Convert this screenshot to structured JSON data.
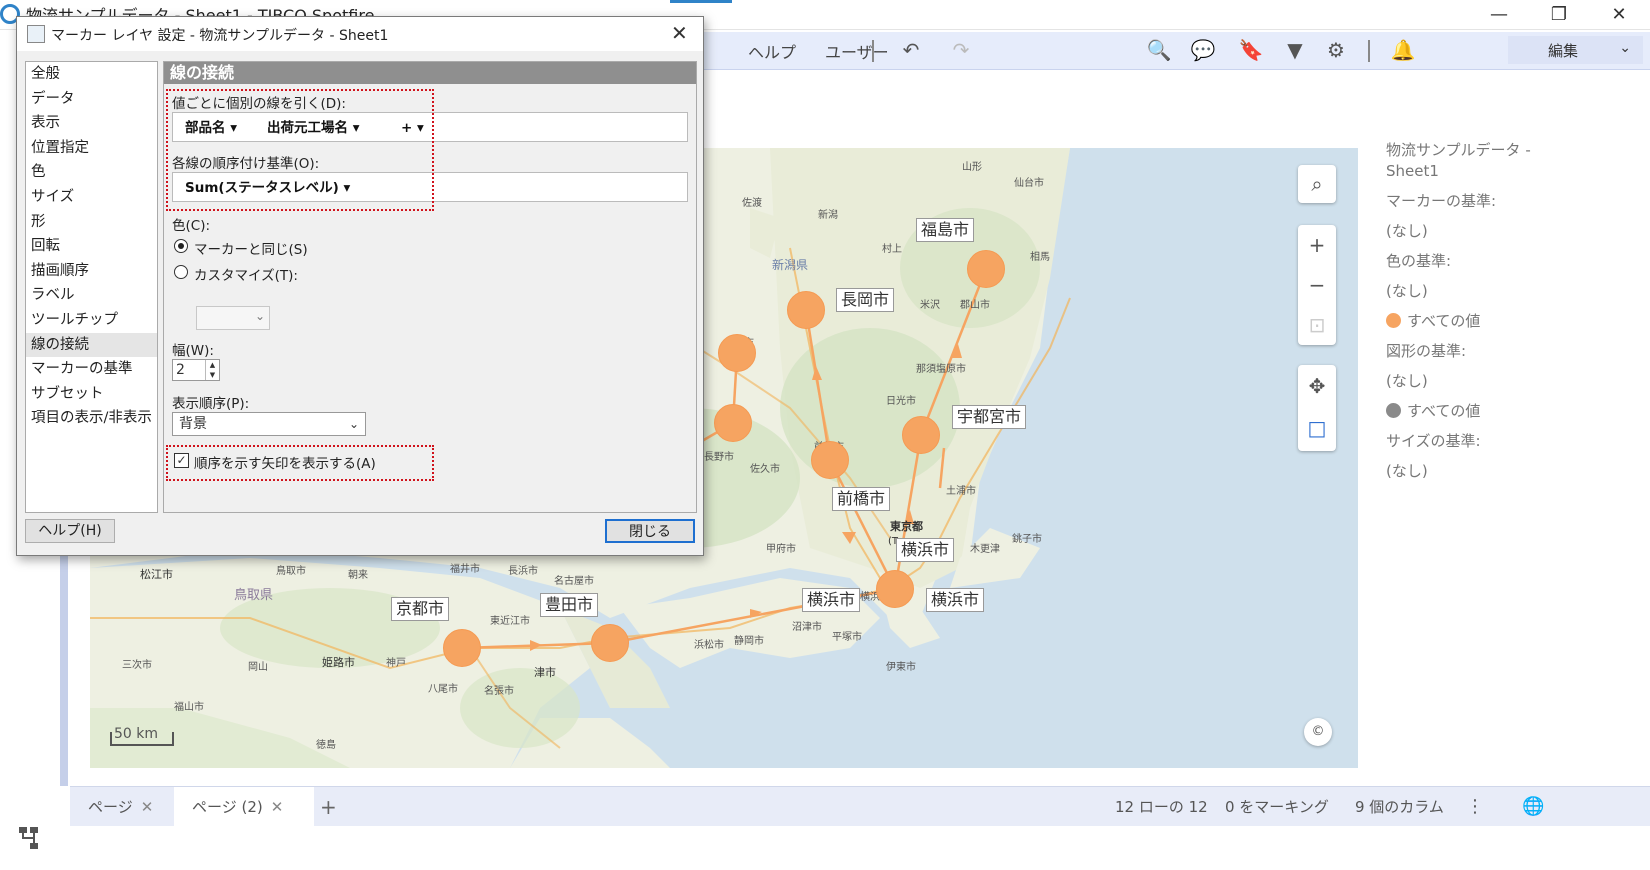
{
  "app": {
    "title": "物流サンプルデータ - Sheet1 - TIBCO Spotfire",
    "min": "—",
    "max": "❐",
    "close": "✕"
  },
  "toolbar": {
    "help": "ヘルプ",
    "user": "ユーザー",
    "edit": "編集",
    "edit_chevron": "⌄",
    "icons": {
      "undo": "↶",
      "redo": "↷",
      "search": "🔍",
      "comments": "💬",
      "bookmark": "🔖",
      "filter": "▼",
      "settings": "⚙",
      "notifications": "🔔"
    }
  },
  "dialog": {
    "title": "マーカー レイヤ 設定 - 物流サンプルデータ - Sheet1",
    "close": "✕",
    "nav": [
      "全般",
      "データ",
      "表示",
      "位置指定",
      "色",
      "サイズ",
      "形",
      "回転",
      "描画順序",
      "ラベル",
      "ツールチップ",
      "線の接続",
      "マーカーの基準",
      "サブセット",
      "項目の表示/非表示"
    ],
    "selected_nav": "線の接続",
    "panel": {
      "header": "線の接続",
      "line_by_label": "値ごとに個別の線を引く(D):",
      "line_by_tokens": [
        "部品名 ▾",
        "出荷元工場名 ▾",
        "+ ▾"
      ],
      "order_label": "各線の順序付け基準(O):",
      "order_token": "Sum(ステータスレベル) ▾",
      "color_label": "色(C):",
      "color_same": "マーカーと同じ(S)",
      "color_custom": "カスタマイズ(T):",
      "color_chev": "⌄",
      "width_label": "幅(W):",
      "width_value": "2",
      "spin_up": "▲",
      "spin_down": "▼",
      "display_order_label": "表示順序(P):",
      "display_order_value": "背景",
      "select_chev": "⌄",
      "arrows_label": "順序を示す矢印を表示する(A)",
      "arrows_checked": "✓"
    },
    "help_button": "ヘルプ(H)",
    "close_button": "閉じる"
  },
  "map": {
    "cities": [
      "福島市",
      "長岡市",
      "宇都宮市",
      "前橋市",
      "横浜市",
      "横浜市",
      "横浜市",
      "豊田市",
      "京都市"
    ],
    "scale": "50 km",
    "tools": {
      "search": "⌕",
      "zoom_in": "+",
      "zoom_out": "−",
      "zoom_fit": "⊡",
      "pan": "✥",
      "select": "□",
      "copyright": "©"
    },
    "bg_labels": [
      "新潟県",
      "鳥取県",
      "山形",
      "仙台市",
      "新潟",
      "佐渡",
      "郡山市",
      "相馬",
      "日光市",
      "那須塩原市",
      "前橋市",
      "土浦市",
      "東京都",
      "(T",
      "甲府市",
      "横浜市",
      "静岡市",
      "沼津市",
      "浜松市",
      "名古屋市",
      "津市",
      "東近江市",
      "長浜市",
      "福井市",
      "姫路市",
      "神戸",
      "岡山",
      "三次市",
      "福山市",
      "松江市",
      "鳥取市",
      "朝来",
      "八尾市",
      "名張市",
      "徳島",
      "佐久市",
      "長野市",
      "上越市",
      "銚子市",
      "木更津",
      "平塚市",
      "伊東市",
      "村上",
      "米沢"
    ]
  },
  "legend": {
    "title": "物流サンプルデータ - Sheet1",
    "marker_by": "マーカーの基準:",
    "marker_by_value": "(なし)",
    "color_by": "色の基準:",
    "color_by_value": "(なし)",
    "color_item": "すべての値",
    "shape_by": "図形の基準:",
    "shape_by_value": "(なし)",
    "shape_item": "すべての値",
    "size_by": "サイズの基準:",
    "size_by_value": "(なし)",
    "colors": {
      "marker": "#f6a461",
      "shape": "#8a8a8a"
    }
  },
  "status": {
    "tab1": "ページ",
    "tab2": "ページ (2)",
    "tab_close": "✕",
    "add": "+",
    "rows": "12 ローの 12",
    "marked": "0 をマーキング",
    "columns": "9 個のカラム",
    "more": "⋮",
    "globe": "🌐"
  },
  "colors": {
    "accent": "#2f83c8",
    "line": "#f6a461",
    "dotted_highlight": "#d0121b"
  }
}
